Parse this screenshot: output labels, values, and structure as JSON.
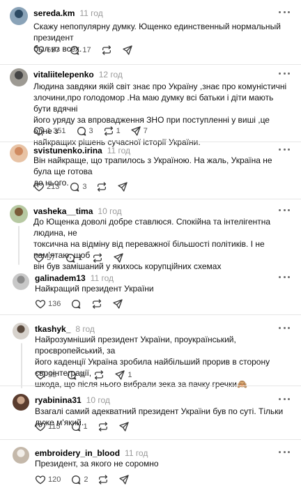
{
  "comments": [
    {
      "username": "sereda.km",
      "time": "11 год",
      "text": "Скажу непопулярну думку. Ющенко единственный нормальный президент\nбыл из всех.",
      "likes": "657",
      "replies": "17",
      "reposts": "",
      "shares": ""
    },
    {
      "username": "vitaliitelepenko",
      "time": "12 год",
      "text": "Людина завдяки якій світ знає про Україну ,знає про комуністичні\nзлочини,про голодомор .На маю думку всі батьки і діти мають бути вдячні\nйого уряду за впровадження ЗНО при поступленні у виші ,це одне з\nнайкращих рішень сучасної історії України.",
      "likes": "1 351",
      "replies": "3",
      "reposts": "1",
      "shares": "7"
    },
    {
      "username": "svistunenko.irina",
      "time": "11 год",
      "text": "Він найкраще, що трапилось з Україною. На жаль, Україна не була ще готова\nдо нього.",
      "likes": "213",
      "replies": "3",
      "reposts": "",
      "shares": ""
    },
    {
      "username": "vasheka__tima",
      "time": "10 год",
      "text": "До Ющенка доволі добре ставлюся. Спокійна та інтелігентна людина, не\nтоксична на відміну від переважної більшості політиків. І не пам'ятаю, щоб\nвін був замішаний у якихось корупційних схемах",
      "likes": "57",
      "replies": "1",
      "reposts": "",
      "shares": ""
    },
    {
      "username": "galinadem13",
      "time": "11 год",
      "text": "Найкращий президент України",
      "likes": "136",
      "replies": "",
      "reposts": "",
      "shares": ""
    },
    {
      "username": "tkashyk_",
      "time": "8 год",
      "text": "Найрозумніший президент України, проукраїнський, проєвропейський, за\nйого каденції Україна зробила найбільший прорив в сторону євроінтеграції,\nшкода, що після нього вибрали зека за пачку гречки🙈",
      "likes": "55",
      "replies": "2",
      "reposts": "",
      "shares": "1"
    },
    {
      "username": "ryabinina31",
      "time": "10 год",
      "text": "Взагалі самий адекватний президент України був по суті. Тільки дуже м'який.",
      "likes": "115",
      "replies": "1",
      "reposts": "",
      "shares": ""
    },
    {
      "username": "embroidery_in_blood",
      "time": "11 год",
      "text": "Президент, за якого не соромно",
      "likes": "120",
      "replies": "2",
      "reposts": "",
      "shares": ""
    }
  ],
  "icons": {
    "like": "heart-icon",
    "reply": "comment-icon",
    "repost": "repost-icon",
    "share": "share-icon",
    "more": "more-options-icon"
  },
  "colors": {
    "text": "#111111",
    "muted": "#999999",
    "icon": "#3a3a3a",
    "divider": "#e6e6e6"
  }
}
